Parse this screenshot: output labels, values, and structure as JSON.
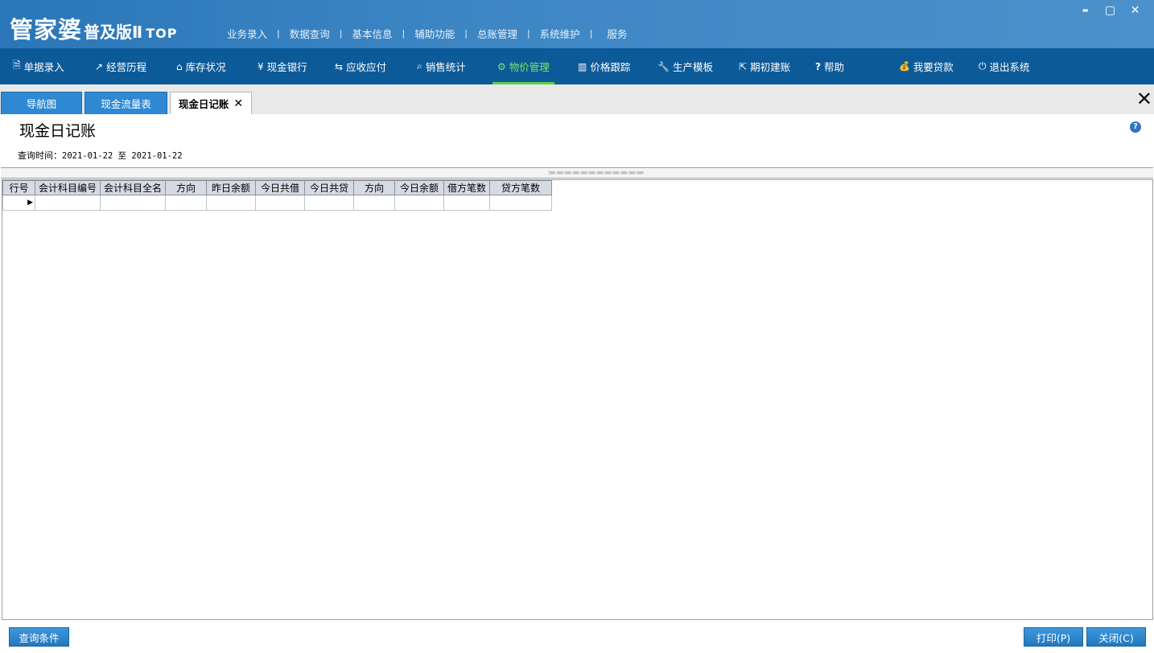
{
  "app": {
    "logo_main": "管家婆",
    "logo_sub": "普及版Ⅱ",
    "logo_top": "TOP"
  },
  "top_menu": [
    "业务录入",
    "数据查询",
    "基本信息",
    "辅助功能",
    "总账管理",
    "系统维护",
    "服务"
  ],
  "window_controls": {
    "minimize": "▬",
    "maximize": "▢",
    "close": "✕"
  },
  "toolbar": [
    {
      "label": "单据录入",
      "icon": "document-icon",
      "glyph": "🗎"
    },
    {
      "label": "经营历程",
      "icon": "chart-line-icon",
      "glyph": "↗"
    },
    {
      "label": "库存状况",
      "icon": "home-icon",
      "glyph": "⌂"
    },
    {
      "label": "现金银行",
      "icon": "yen-icon",
      "glyph": "¥"
    },
    {
      "label": "应收应付",
      "icon": "transfer-icon",
      "glyph": "⇆"
    },
    {
      "label": "销售统计",
      "icon": "search-icon",
      "glyph": "⌕"
    },
    {
      "label": "物价管理",
      "icon": "gear-icon",
      "glyph": "⚙"
    },
    {
      "label": "价格跟踪",
      "icon": "bar-chart-icon",
      "glyph": "▥"
    },
    {
      "label": "生产模板",
      "icon": "wrench-icon",
      "glyph": "🔧"
    },
    {
      "label": "期初建账",
      "icon": "external-link-icon",
      "glyph": "⇱"
    },
    {
      "label": "帮助",
      "icon": "question-icon",
      "glyph": "?"
    },
    {
      "label": "我要贷款",
      "icon": "money-bag-icon",
      "glyph": "💰"
    },
    {
      "label": "退出系统",
      "icon": "power-icon",
      "glyph": "⏻"
    }
  ],
  "active_toolbar": "物价管理",
  "tabs": [
    {
      "label": "导航图"
    },
    {
      "label": "现金流量表"
    },
    {
      "label": "现金日记账",
      "close": "✕"
    }
  ],
  "tabstrip_close": "✕",
  "page": {
    "title": "现金日记账",
    "help": "?",
    "query_label": "查询时间：",
    "query_value": "2021-01-22 至 2021-01-22"
  },
  "grid": {
    "columns": [
      "行号",
      "会计科目编号",
      "会计科目全名",
      "方向",
      "昨日余额",
      "今日共借",
      "今日共贷",
      "方向",
      "今日余额",
      "借方笔数",
      "贷方笔数"
    ],
    "row_indicator": "▶"
  },
  "buttons": {
    "query_conditions": "查询条件",
    "print": "打印(P)",
    "close": "关闭(C)"
  }
}
